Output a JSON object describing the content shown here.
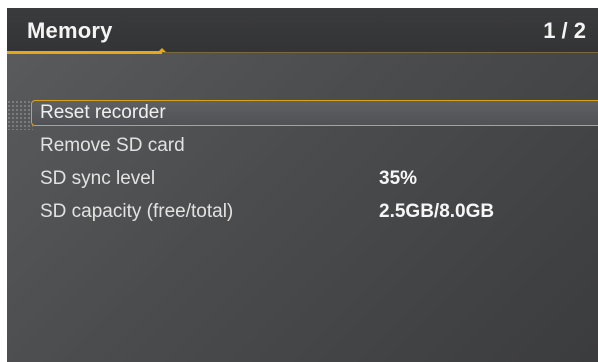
{
  "header": {
    "title": "Memory",
    "page_indicator": "1 / 2"
  },
  "colors": {
    "accent": "#e6a817",
    "background": "#4a4c4e",
    "text": "#e2e2e2"
  },
  "menu": {
    "items": [
      {
        "label": "Reset recorder",
        "value": "",
        "selected": true
      },
      {
        "label": "Remove SD card",
        "value": "",
        "selected": false
      },
      {
        "label": "SD sync level",
        "value": "35%",
        "selected": false
      },
      {
        "label": "SD capacity (free/total)",
        "value": "2.5GB/8.0GB",
        "selected": false
      }
    ]
  }
}
